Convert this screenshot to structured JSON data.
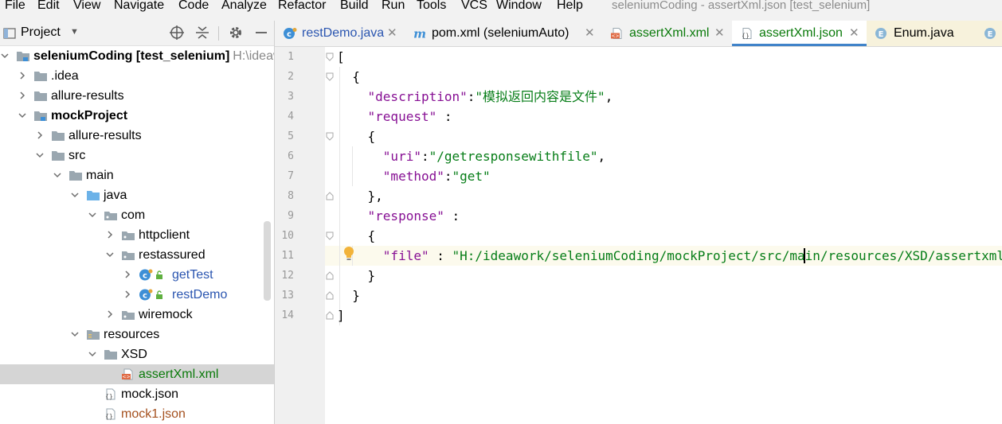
{
  "menu": [
    "File",
    "Edit",
    "View",
    "Navigate",
    "Code",
    "Analyze",
    "Refactor",
    "Build",
    "Run",
    "Tools",
    "VCS",
    "Window",
    "Help"
  ],
  "window_title": "seleniumCoding - assertXml.json [test_selenium]",
  "project_pane": {
    "title": "Project",
    "tree": [
      {
        "label": "seleniumCoding",
        "suffix": "[test_selenium]",
        "extra": "H:\\ideaw",
        "level": 0,
        "expanded": true,
        "icon": "module-folder-icon",
        "bold": true,
        "color": "#000000"
      },
      {
        "label": ".idea",
        "level": 1,
        "expanded": false,
        "icon": "folder-icon",
        "color": "#000000"
      },
      {
        "label": "allure-results",
        "level": 1,
        "expanded": false,
        "icon": "folder-icon",
        "color": "#000000"
      },
      {
        "label": "mockProject",
        "level": 1,
        "expanded": true,
        "icon": "module-folder-icon",
        "bold": true,
        "color": "#000000"
      },
      {
        "label": "allure-results",
        "level": 2,
        "expanded": false,
        "icon": "folder-icon",
        "color": "#000000"
      },
      {
        "label": "src",
        "level": 2,
        "expanded": true,
        "icon": "folder-icon",
        "color": "#000000"
      },
      {
        "label": "main",
        "level": 3,
        "expanded": true,
        "icon": "folder-icon",
        "color": "#000000"
      },
      {
        "label": "java",
        "level": 4,
        "expanded": true,
        "icon": "source-folder-icon",
        "color": "#000000"
      },
      {
        "label": "com",
        "level": 5,
        "expanded": true,
        "icon": "package-icon",
        "color": "#000000"
      },
      {
        "label": "httpclient",
        "level": 6,
        "expanded": false,
        "icon": "package-icon",
        "color": "#000000"
      },
      {
        "label": "restassured",
        "level": 6,
        "expanded": true,
        "icon": "package-icon",
        "color": "#000000"
      },
      {
        "label": "getTest",
        "level": 7,
        "expanded": false,
        "icon": "java-class-icon",
        "color": "#2a55b0"
      },
      {
        "label": "restDemo",
        "level": 7,
        "expanded": false,
        "icon": "java-class-icon",
        "color": "#2a55b0"
      },
      {
        "label": "wiremock",
        "level": 6,
        "expanded": false,
        "icon": "package-icon",
        "color": "#000000"
      },
      {
        "label": "resources",
        "level": 4,
        "expanded": true,
        "icon": "resources-folder-icon",
        "color": "#000000"
      },
      {
        "label": "XSD",
        "level": 5,
        "expanded": true,
        "icon": "folder-icon",
        "color": "#000000"
      },
      {
        "label": "assertXml.xml",
        "level": 6,
        "leaf": true,
        "icon": "xml-file-icon",
        "color": "#0a7a0a",
        "selected": true
      },
      {
        "label": "mock.json",
        "level": 5,
        "leaf": true,
        "icon": "json-file-icon",
        "color": "#000000"
      },
      {
        "label": "mock1.json",
        "level": 5,
        "leaf": true,
        "icon": "json-file-icon",
        "color": "#a4501e"
      }
    ]
  },
  "tabs": [
    {
      "label": "restDemo.java",
      "icon": "java-class-icon",
      "color": "#2a55b0",
      "active": false
    },
    {
      "label": "pom.xml (seleniumAuto)",
      "icon": "maven-icon",
      "color": "#000000",
      "active": false
    },
    {
      "label": "assertXml.xml",
      "icon": "xml-file-icon",
      "color": "#0a7a0a",
      "active": false
    },
    {
      "label": "assertXml.json",
      "icon": "json-file-icon",
      "color": "#0a7a0a",
      "active": true
    },
    {
      "label": "Enum.java",
      "icon": "enum-icon",
      "color": "#000000",
      "active": false,
      "highlight": true
    }
  ],
  "editor": {
    "line_numbers": [
      "1",
      "2",
      "3",
      "4",
      "5",
      "6",
      "7",
      "8",
      "9",
      "10",
      "11",
      "12",
      "13",
      "14"
    ],
    "lines": [
      [
        {
          "t": "[",
          "c": "p"
        }
      ],
      [
        {
          "t": "  {",
          "c": "p"
        }
      ],
      [
        {
          "t": "    ",
          "c": "p"
        },
        {
          "t": "\"description\"",
          "c": "k"
        },
        {
          "t": ":",
          "c": "p"
        },
        {
          "t": "\"模拟返回内容是文件\"",
          "c": "s"
        },
        {
          "t": ",",
          "c": "p"
        }
      ],
      [
        {
          "t": "    ",
          "c": "p"
        },
        {
          "t": "\"request\"",
          "c": "k"
        },
        {
          "t": " :",
          "c": "p"
        }
      ],
      [
        {
          "t": "    {",
          "c": "p"
        }
      ],
      [
        {
          "t": "      ",
          "c": "p"
        },
        {
          "t": "\"uri\"",
          "c": "k"
        },
        {
          "t": ":",
          "c": "p"
        },
        {
          "t": "\"/getresponsewithfile\"",
          "c": "s"
        },
        {
          "t": ",",
          "c": "p"
        }
      ],
      [
        {
          "t": "      ",
          "c": "p"
        },
        {
          "t": "\"method\"",
          "c": "k"
        },
        {
          "t": ":",
          "c": "p"
        },
        {
          "t": "\"get\"",
          "c": "s"
        }
      ],
      [
        {
          "t": "    },",
          "c": "p"
        }
      ],
      [
        {
          "t": "    ",
          "c": "p"
        },
        {
          "t": "\"response\"",
          "c": "k"
        },
        {
          "t": " :",
          "c": "p"
        }
      ],
      [
        {
          "t": "    {",
          "c": "p"
        }
      ],
      [
        {
          "t": "      ",
          "c": "p"
        },
        {
          "t": "\"file\"",
          "c": "k"
        },
        {
          "t": " : ",
          "c": "p"
        },
        {
          "t": "\"H:/ideawork/seleniumCoding/mockProject/src/main/resources/XSD/assertxml.xml\"",
          "c": "s"
        }
      ],
      [
        {
          "t": "    }",
          "c": "p"
        }
      ],
      [
        {
          "t": "  }",
          "c": "p"
        }
      ],
      [
        {
          "t": "]",
          "c": "p"
        }
      ]
    ]
  }
}
